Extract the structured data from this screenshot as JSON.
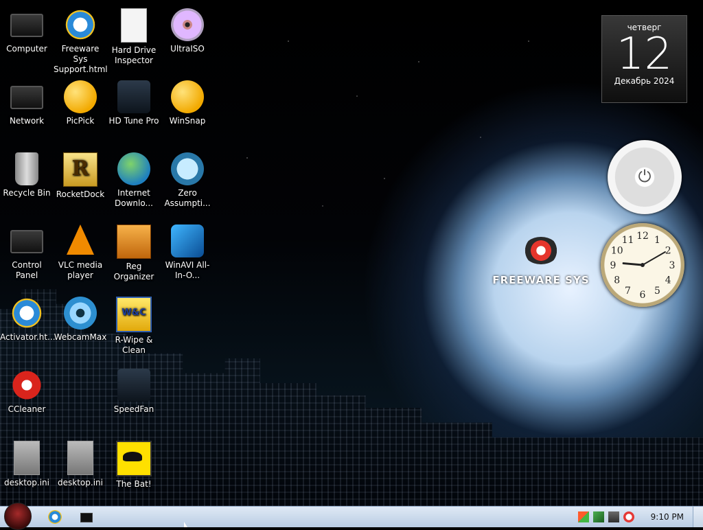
{
  "desktop": {
    "icons": [
      {
        "label": "Computer",
        "icon": "computer-icon"
      },
      {
        "label": "Freeware Sys Support.html",
        "icon": "ie-document-icon"
      },
      {
        "label": "Hard Drive Inspector",
        "icon": "hard-drive-inspector-icon"
      },
      {
        "label": "UltraISO",
        "icon": "disc-icon"
      },
      {
        "label": "Network",
        "icon": "network-icon"
      },
      {
        "label": "PicPick",
        "icon": "palette-icon"
      },
      {
        "label": "HD Tune Pro",
        "icon": "hard-disk-icon"
      },
      {
        "label": "WinSnap",
        "icon": "winsnap-icon"
      },
      {
        "label": "Recycle Bin",
        "icon": "recycle-bin-icon"
      },
      {
        "label": "RocketDock",
        "icon": "rocketdock-icon"
      },
      {
        "label": "Internet Downlo...",
        "icon": "download-manager-icon"
      },
      {
        "label": "Zero Assumpti...",
        "icon": "zero-assumption-icon"
      },
      {
        "label": "Control Panel",
        "icon": "control-panel-icon"
      },
      {
        "label": "VLC media player",
        "icon": "vlc-icon"
      },
      {
        "label": "Reg Organizer",
        "icon": "reg-organizer-icon"
      },
      {
        "label": "WinAVI All-In-O...",
        "icon": "winavi-icon"
      },
      {
        "label": "Activator.ht...",
        "icon": "ie-document-icon"
      },
      {
        "label": "WebcamMax",
        "icon": "webcam-icon"
      },
      {
        "label": "R-Wipe & Clean",
        "icon": "rwipe-icon"
      },
      {
        "label": "CCleaner",
        "icon": "ccleaner-icon"
      },
      {
        "label": "SpeedFan",
        "icon": "speedfan-icon"
      },
      {
        "label": "desktop.ini",
        "icon": "settings-file-icon"
      },
      {
        "label": "desktop.ini",
        "icon": "settings-file-icon"
      },
      {
        "label": "The Bat!",
        "icon": "thebat-icon"
      }
    ]
  },
  "widgets": {
    "calendar": {
      "day": "четверг",
      "date": "12",
      "month": "Декабрь 2024"
    },
    "logo_text": "FREEWARE SYS",
    "clock_numbers": [
      "12",
      "1",
      "2",
      "3",
      "4",
      "5",
      "6",
      "7",
      "8",
      "9",
      "10",
      "11"
    ],
    "clock_time": {
      "hour": 9,
      "minute": 10
    }
  },
  "taskbar": {
    "time": "9:10 PM",
    "pinned": [
      "internet-explorer-icon",
      "command-prompt-icon"
    ],
    "tray": [
      "action-center-flag-icon",
      "pen-icon",
      "network-icon",
      "volume-icon"
    ]
  }
}
